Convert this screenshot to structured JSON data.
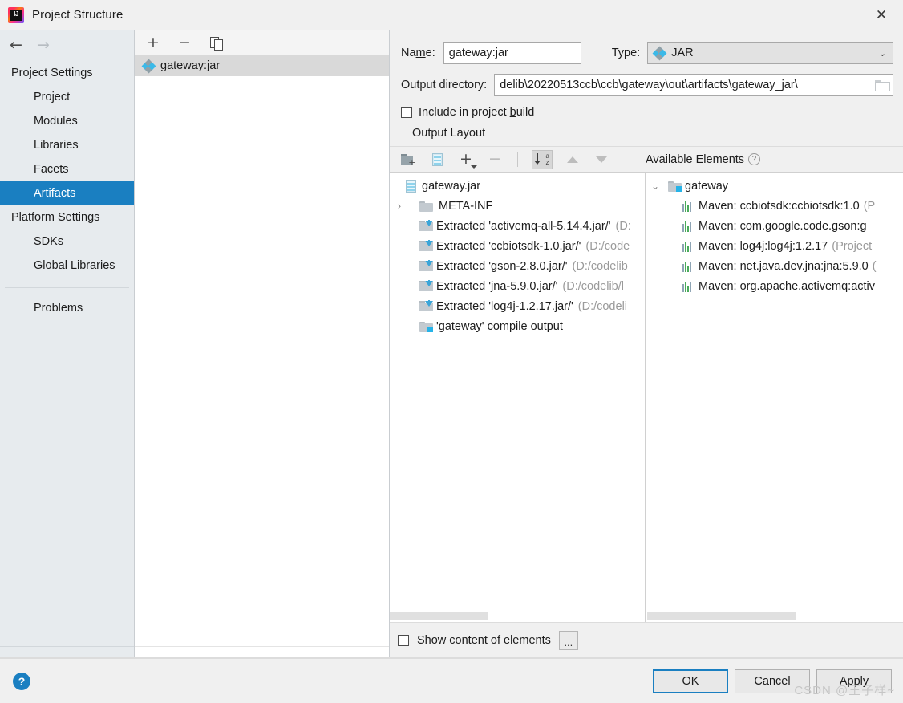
{
  "window": {
    "title": "Project Structure",
    "logo_icon": "intellij-idea-logo",
    "logo_text": "IJ",
    "close_icon": "✕"
  },
  "nav": {
    "back_icon": "←",
    "forward_icon": "→",
    "sections": [
      {
        "group": "Project Settings",
        "items": [
          {
            "label": "Project",
            "selected": false
          },
          {
            "label": "Modules",
            "selected": false
          },
          {
            "label": "Libraries",
            "selected": false
          },
          {
            "label": "Facets",
            "selected": false
          },
          {
            "label": "Artifacts",
            "selected": true
          }
        ]
      },
      {
        "group": "Platform Settings",
        "items": [
          {
            "label": "SDKs",
            "selected": false
          },
          {
            "label": "Global Libraries",
            "selected": false
          }
        ]
      }
    ],
    "problems_label": "Problems",
    "selected_color": "#1a7fc1"
  },
  "artifacts_panel": {
    "toolbar": [
      {
        "name": "add-artifact-button",
        "icon": "plus-icon",
        "glyph": "+"
      },
      {
        "name": "remove-artifact-button",
        "icon": "minus-icon",
        "glyph": "−"
      },
      {
        "name": "copy-artifact-button",
        "icon": "copy-icon",
        "glyph": ""
      }
    ],
    "items": [
      {
        "label": "gateway:jar",
        "icon": "artifact-jar-icon",
        "selected": true
      }
    ]
  },
  "form": {
    "name_label": "Name:",
    "name_label_pre": "Na",
    "name_label_mnemonic": "m",
    "name_label_post": "e:",
    "name_value": "gateway:jar",
    "type_label": "Type:",
    "type_value": "JAR",
    "type_chevron": "⌄",
    "output_dir_label": "Output directory:",
    "output_dir_value": "\\delib\\20220513ccb\\ccb\\gateway\\out\\artifacts\\gateway_jar",
    "browse_icon": "folder-browse-icon",
    "include_in_build_label": "Include in project build",
    "include_in_build_checked": false,
    "output_layout_label": "Output Layout"
  },
  "layout_toolbar": {
    "buttons": [
      {
        "name": "create-directory-button",
        "icon": "new-folder-icon"
      },
      {
        "name": "create-archive-button",
        "icon": "jar-archive-icon"
      },
      {
        "name": "add-element-button",
        "icon": "plus-dropdown-icon",
        "glyph": "+"
      },
      {
        "name": "remove-element-button",
        "icon": "minus-icon",
        "glyph": "−"
      },
      {
        "name": "sort-elements-button",
        "icon": "sort-alphabetical-icon",
        "active": true
      },
      {
        "name": "move-up-button",
        "icon": "triangle-up-icon"
      },
      {
        "name": "move-down-button",
        "icon": "triangle-down-icon"
      }
    ],
    "available_elements_label": "Available Elements",
    "help_icon": "?"
  },
  "output_tree": {
    "rows": [
      {
        "indent": 0,
        "twisty": "",
        "icon": "jar-archive-icon",
        "text": "gateway.jar",
        "dim": ""
      },
      {
        "indent": 1,
        "twisty": "›",
        "icon": "folder-icon",
        "text": "META-INF",
        "dim": ""
      },
      {
        "indent": 1,
        "twisty": "",
        "icon": "extracted-icon",
        "text": "Extracted 'activemq-all-5.14.4.jar/'",
        "dim": "(D:"
      },
      {
        "indent": 1,
        "twisty": "",
        "icon": "extracted-icon",
        "text": "Extracted 'ccbiotsdk-1.0.jar/'",
        "dim": "(D:/code"
      },
      {
        "indent": 1,
        "twisty": "",
        "icon": "extracted-icon",
        "text": "Extracted 'gson-2.8.0.jar/'",
        "dim": "(D:/codelib"
      },
      {
        "indent": 1,
        "twisty": "",
        "icon": "extracted-icon",
        "text": "Extracted 'jna-5.9.0.jar/'",
        "dim": "(D:/codelib/l"
      },
      {
        "indent": 1,
        "twisty": "",
        "icon": "extracted-icon",
        "text": "Extracted 'log4j-1.2.17.jar/'",
        "dim": "(D:/codeli"
      },
      {
        "indent": 1,
        "twisty": "",
        "icon": "module-output-icon",
        "text": "'gateway' compile output",
        "dim": ""
      }
    ]
  },
  "available_tree": {
    "rows": [
      {
        "indent": 0,
        "twisty": "⌄",
        "icon": "module-folder-icon",
        "text": "gateway",
        "dim": ""
      },
      {
        "indent": 1,
        "twisty": "",
        "icon": "maven-library-icon",
        "text": "Maven: ccbiotsdk:ccbiotsdk:1.0",
        "dim": "(P"
      },
      {
        "indent": 1,
        "twisty": "",
        "icon": "maven-library-icon",
        "text": "Maven: com.google.code.gson:g",
        "dim": ""
      },
      {
        "indent": 1,
        "twisty": "",
        "icon": "maven-library-icon",
        "text": "Maven: log4j:log4j:1.2.17",
        "dim": "(Project"
      },
      {
        "indent": 1,
        "twisty": "",
        "icon": "maven-library-icon",
        "text": "Maven: net.java.dev.jna:jna:5.9.0",
        "dim": "("
      },
      {
        "indent": 1,
        "twisty": "",
        "icon": "maven-library-icon",
        "text": "Maven: org.apache.activemq:activ",
        "dim": ""
      }
    ]
  },
  "footer": {
    "show_content_label": "Show content of elements",
    "show_content_checked": false,
    "ellipsis_label": "...",
    "help_button_label": "?",
    "ok_label": "OK",
    "cancel_label": "Cancel",
    "apply_label": "Apply",
    "watermark": "CSDN @王子样~"
  }
}
